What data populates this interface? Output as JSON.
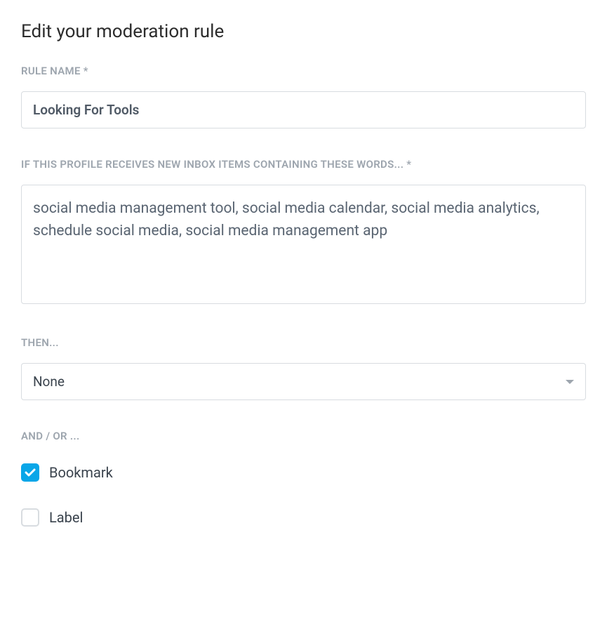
{
  "page": {
    "title": "Edit your moderation rule"
  },
  "fields": {
    "rule_name": {
      "label": "RULE NAME *",
      "value": "Looking For Tools"
    },
    "keywords": {
      "label": "IF THIS PROFILE RECEIVES NEW INBOX ITEMS CONTAINING THESE WORDS... *",
      "value": "social media management tool, social media calendar, social media analytics, schedule social media, social media management app"
    },
    "then": {
      "label": "THEN...",
      "selected": "None"
    },
    "and_or": {
      "label": "AND / OR ...",
      "options": {
        "bookmark": {
          "label": "Bookmark",
          "checked": true
        },
        "label": {
          "label": "Label",
          "checked": false
        }
      }
    }
  }
}
